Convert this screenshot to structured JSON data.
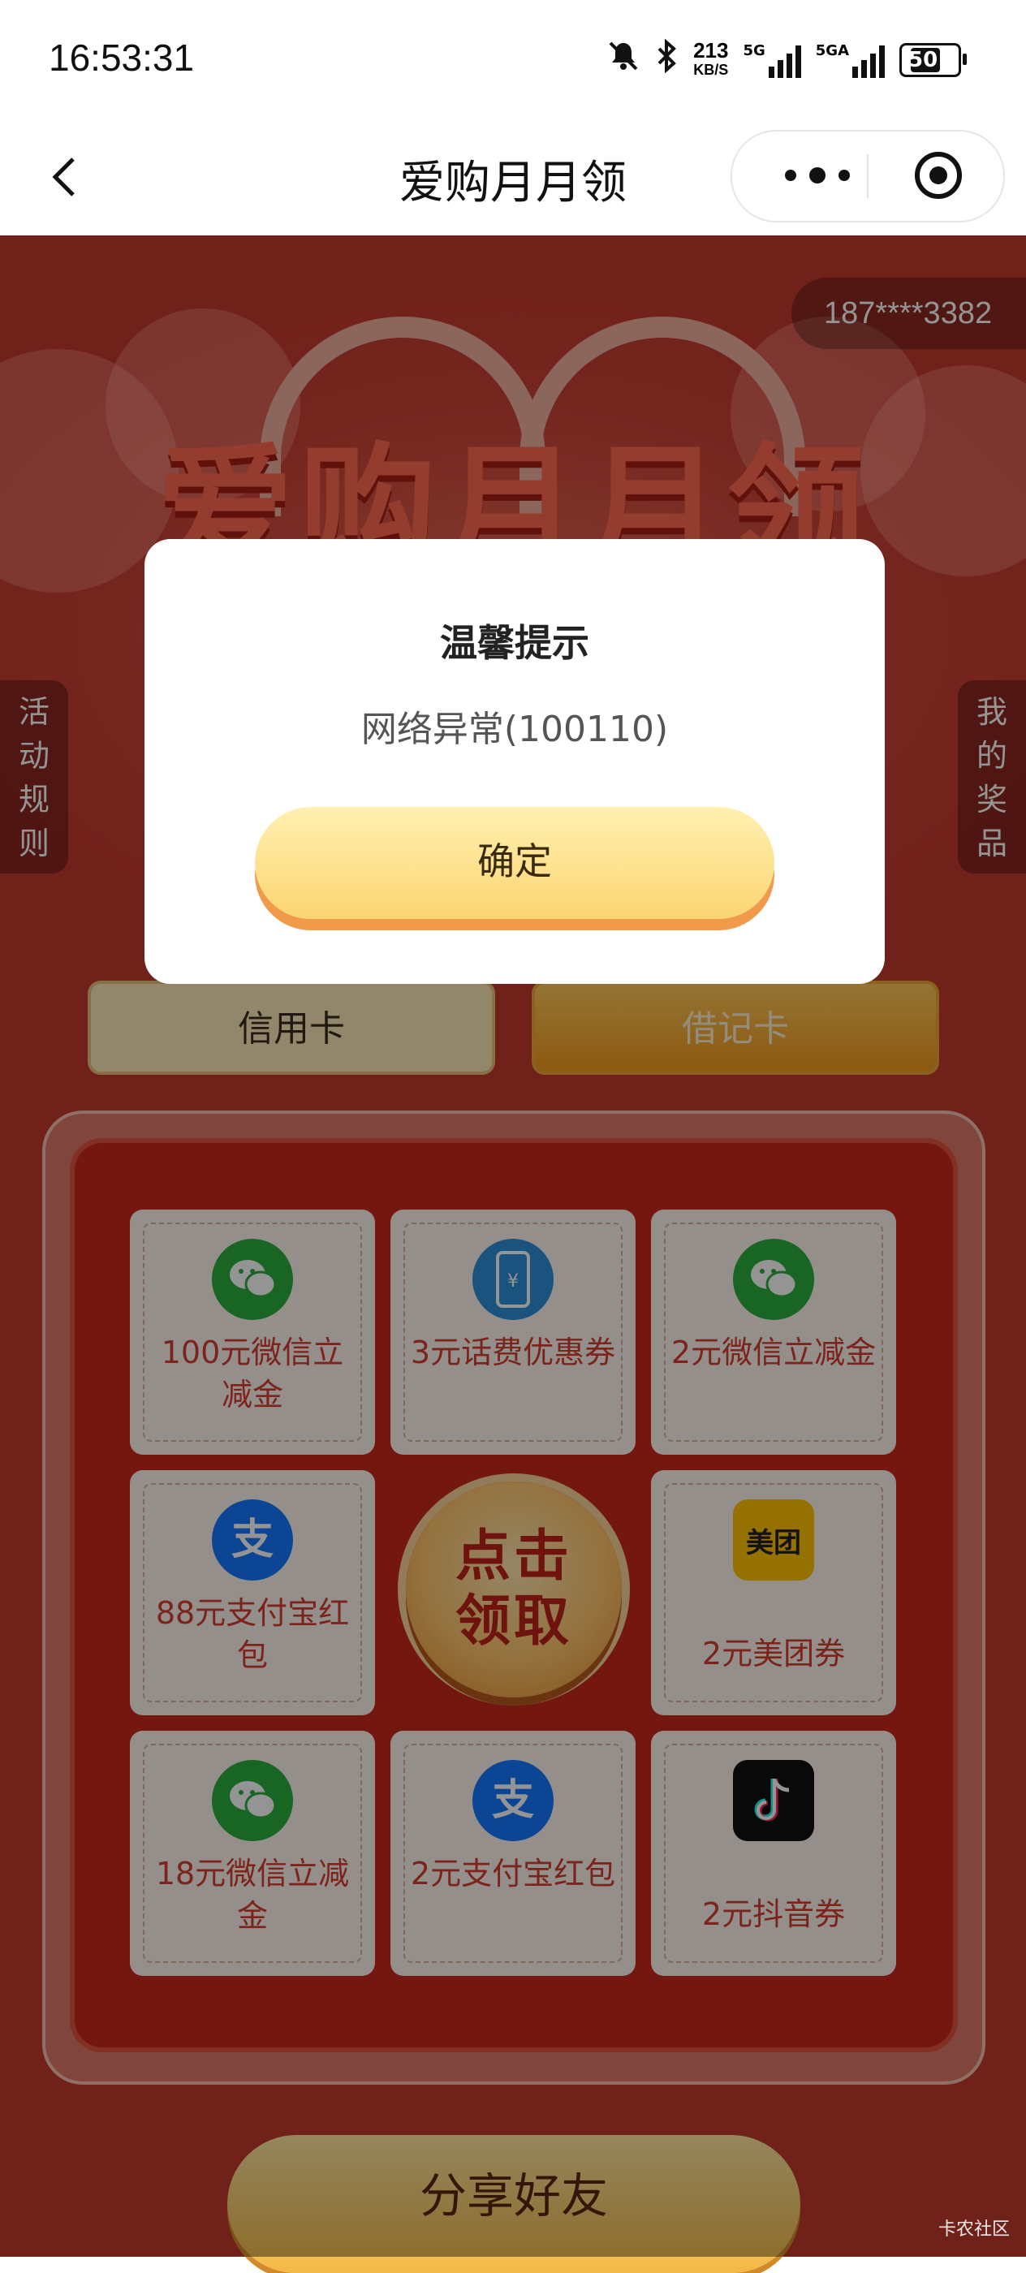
{
  "status_bar": {
    "time": "16:53:31",
    "speed_value": "213",
    "speed_unit": "KB/S",
    "net1": "5G",
    "net2": "5GA",
    "battery": "50"
  },
  "nav": {
    "title": "爱购月月领"
  },
  "hero": {
    "title": "爱购月月领",
    "phone": "187****3382"
  },
  "side_tabs": {
    "left_label": "活动规则",
    "right_label": "我的奖品"
  },
  "card_tabs": {
    "credit": "信用卡",
    "debit": "借记卡"
  },
  "prizes": [
    {
      "label": "100元微信立减金",
      "icon": "wechat-icon"
    },
    {
      "label": "3元话费优惠券",
      "icon": "phone-bill-icon"
    },
    {
      "label": "2元微信立减金",
      "icon": "wechat-icon"
    },
    {
      "label": "88元支付宝红包",
      "icon": "alipay-icon"
    },
    {
      "label": "2元美团券",
      "icon": "meituan-icon"
    },
    {
      "label": "18元微信立减金",
      "icon": "wechat-icon"
    },
    {
      "label": "2元支付宝红包",
      "icon": "alipay-icon"
    },
    {
      "label": "2元抖音券",
      "icon": "douyin-icon"
    }
  ],
  "meituan_text": "美团",
  "draw_button": {
    "line1": "点击",
    "line2": "领取"
  },
  "share_button": "分享好友",
  "watermark": "卡农社区",
  "dialog": {
    "title": "温馨提示",
    "message": "网络异常(100110)",
    "confirm": "确定"
  },
  "colors": {
    "background_red": "#c23a2e",
    "prize_text": "#d63d30",
    "button_gold": "#fcd572"
  }
}
